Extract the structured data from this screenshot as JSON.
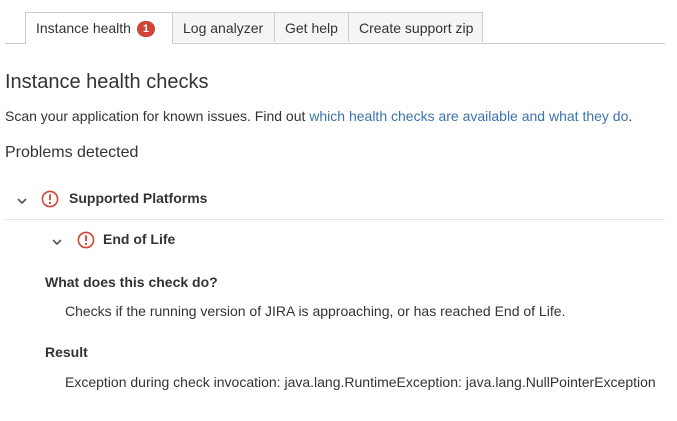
{
  "tabs": [
    {
      "label": "Instance health",
      "badge": "1",
      "active": true
    },
    {
      "label": "Log analyzer",
      "active": false
    },
    {
      "label": "Get help",
      "active": false
    },
    {
      "label": "Create support zip",
      "active": false
    }
  ],
  "page": {
    "title": "Instance health checks",
    "intro_text": "Scan your application for known issues. Find out ",
    "intro_link": "which health checks are available and what they do",
    "intro_end": ".",
    "problems_heading": "Problems detected"
  },
  "checks": {
    "group_label": "Supported Platforms",
    "item_label": "End of Life",
    "what_title": "What does this check do?",
    "what_body": "Checks if the running version of JIRA is approaching, or has reached End of Life.",
    "result_title": "Result",
    "result_body": "Exception during check invocation: java.lang.RuntimeException: java.lang.NullPointerException"
  },
  "colors": {
    "error": "#d04437",
    "link": "#3b73af",
    "tab_inactive_bg": "#f5f5f5",
    "border": "#cccccc"
  },
  "icons": {
    "chevron": "chevron-down-icon",
    "warning": "error-circle-icon"
  }
}
